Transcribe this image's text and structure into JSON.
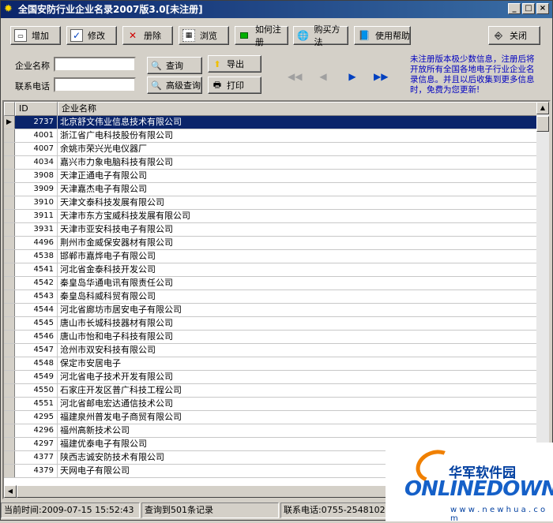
{
  "window": {
    "title": "全国安防行业企业名录2007版3.0[未注册]"
  },
  "titlebar_buttons": [
    "_",
    "□",
    "×"
  ],
  "toolbar": {
    "add": "增加",
    "edit": "修改",
    "delete": "册除",
    "browse": "浏览",
    "register": "如何注册",
    "buy": "购买方法",
    "help": "使用帮助",
    "close": "关闭"
  },
  "form": {
    "company_label": "企业名称",
    "phone_label": "联系电话",
    "company_value": "",
    "phone_value": "",
    "query": "查询",
    "advanced_query": "高级查询",
    "export": "导出",
    "print": "打印"
  },
  "notice": "未注册版本极少数信息，注册后将开放所有全国各地电子行业企业名录信息。并且以后收集到更多信息时，免费为您更新!",
  "grid": {
    "col_id": "ID",
    "col_name": "企业名称",
    "rows": [
      {
        "id": "2737",
        "name": "北京舒文伟业信息技术有限公司"
      },
      {
        "id": "4001",
        "name": "浙江省广电科技股份有限公司"
      },
      {
        "id": "4007",
        "name": "余姚市荣兴光电仪器厂"
      },
      {
        "id": "4034",
        "name": "嘉兴市力象电脑科技有限公司"
      },
      {
        "id": "3908",
        "name": "天津正通电子有限公司"
      },
      {
        "id": "3909",
        "name": "天津嘉杰电子有限公司"
      },
      {
        "id": "3910",
        "name": "天津文泰科技发展有限公司"
      },
      {
        "id": "3911",
        "name": "天津市东方宝威科技发展有限公司"
      },
      {
        "id": "3931",
        "name": "天津市亚安科技电子有限公司"
      },
      {
        "id": "4496",
        "name": "荆州市金威保安器材有限公司"
      },
      {
        "id": "4538",
        "name": "邯郸市嘉烨电子有限公司"
      },
      {
        "id": "4541",
        "name": "河北省金泰科技开发公司"
      },
      {
        "id": "4542",
        "name": "秦皇岛华通电讯有限责任公司"
      },
      {
        "id": "4543",
        "name": "秦皇岛科威科贸有限公司"
      },
      {
        "id": "4544",
        "name": "河北省廊坊市居安电子有限公司"
      },
      {
        "id": "4545",
        "name": "唐山市长城科技器材有限公司"
      },
      {
        "id": "4546",
        "name": "唐山市怡和电子科技有限公司"
      },
      {
        "id": "4547",
        "name": "沧州市双安科技有限公司"
      },
      {
        "id": "4548",
        "name": "保定市安居电子"
      },
      {
        "id": "4549",
        "name": "河北省电子技术开发有限公司"
      },
      {
        "id": "4550",
        "name": "石家庄开发区普广科技工程公司"
      },
      {
        "id": "4551",
        "name": "河北省邮电宏达通信技术公司"
      },
      {
        "id": "4295",
        "name": "福建泉州普发电子商贸有限公司"
      },
      {
        "id": "4296",
        "name": "福州高新技术公司"
      },
      {
        "id": "4297",
        "name": "福建优泰电子有限公司"
      },
      {
        "id": "4377",
        "name": "陕西志诚安防技术有限公司"
      },
      {
        "id": "4379",
        "name": "天网电子有限公司"
      }
    ]
  },
  "status": {
    "time": "当前时间:2009-07-15 15:52:43",
    "count": "查询到501条记录",
    "phone": "联系电话:0755-25481029"
  },
  "watermark": {
    "cn": "华军软件园",
    "en": "ONLINEDOWN",
    "url": "w w w . n e w h u a . c o m"
  }
}
